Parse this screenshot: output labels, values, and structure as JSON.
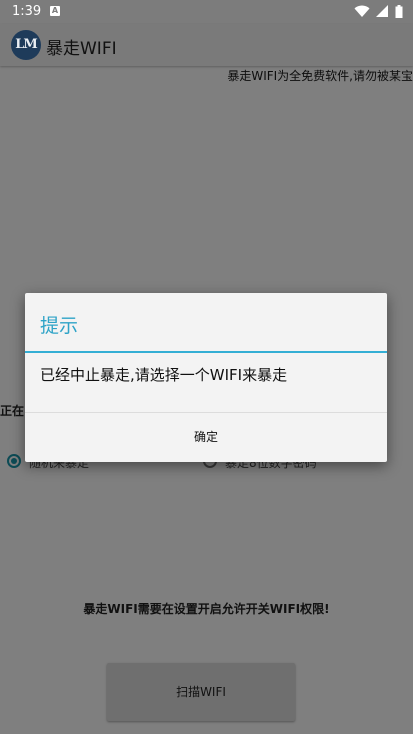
{
  "status_bar": {
    "time": "1:39",
    "notification_icon": "A",
    "icons": [
      "wifi-icon",
      "signal-icon",
      "battery-icon"
    ]
  },
  "app": {
    "title": "暴走WIFI",
    "logo_text": "LM"
  },
  "main": {
    "notice": "暴走WIFI为全免费软件,请勿被某宝",
    "partial_label": "正在",
    "radio_left_label": "随机来暴走",
    "radio_right_label": "暴走8位数字密码",
    "permission_text": "暴走WIFI需要在设置开启允许开关WIFI权限!",
    "scan_button": "扫描WIFI"
  },
  "dialog": {
    "title": "提示",
    "message": "已经中止暴走,请选择一个WIFI来暴走",
    "confirm": "确定"
  },
  "colors": {
    "accent": "#34aed4",
    "title": "#2ea3c7"
  }
}
